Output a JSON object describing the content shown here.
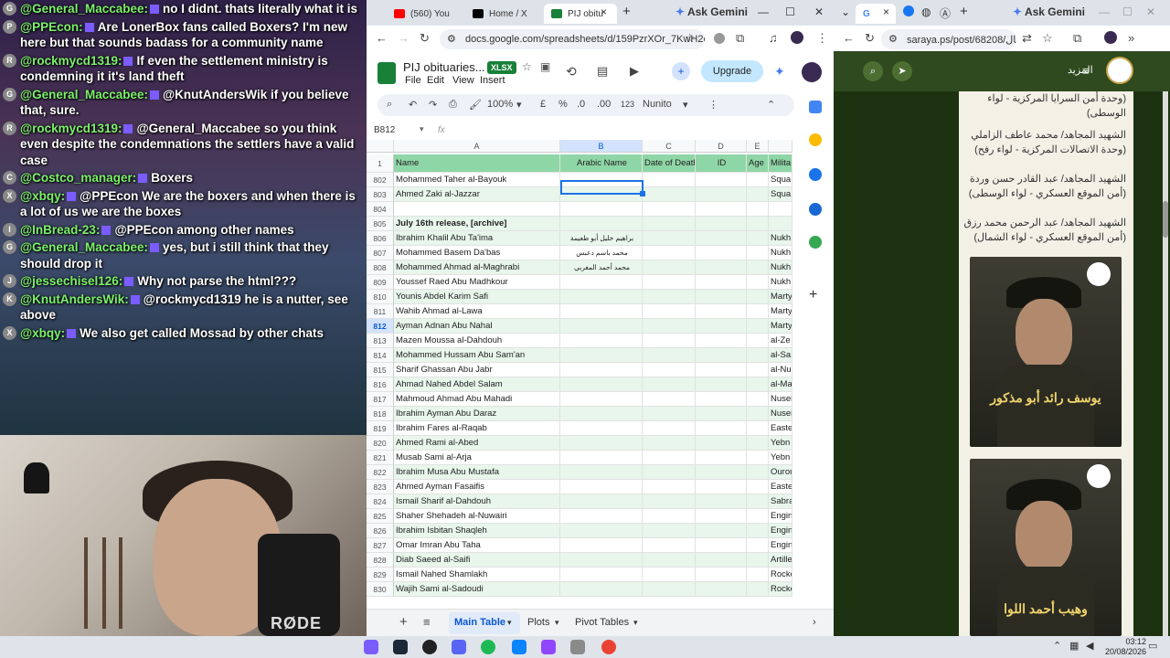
{
  "chat": [
    {
      "user": "@General_Maccabee:",
      "text": "no I didnt. thats literally what it is",
      "avatar": "G"
    },
    {
      "user": "@PPEcon:",
      "text": "Are LonerBox fans called Boxers? I'm new here but that sounds badass for a community name",
      "avatar": "P"
    },
    {
      "user": "@rockmycd1319:",
      "text": "If even the settlement ministry is condemning it it's land theft",
      "avatar": "R"
    },
    {
      "user": "@General_Maccabee:",
      "text": "@KnutAndersWik if you believe that, sure.",
      "avatar": "G"
    },
    {
      "user": "@rockmycd1319:",
      "text": "@General_Maccabee so you think even despite the condemnations the settlers have a valid case",
      "avatar": "R"
    },
    {
      "user": "@Costco_manager:",
      "text": "Boxers",
      "avatar": "C"
    },
    {
      "user": "@xbqy:",
      "text": "@PPEcon We are the boxers and when there is a lot of us we are the boxes",
      "avatar": "X"
    },
    {
      "user": "@InBread-23:",
      "text": "@PPEcon among other names",
      "avatar": "I"
    },
    {
      "user": "@General_Maccabee:",
      "text": "yes, but i still think that they should drop it",
      "avatar": "G"
    },
    {
      "user": "@jessechisel126:",
      "text": "Why not parse the html???",
      "avatar": "J"
    },
    {
      "user": "@KnutAndersWik:",
      "text": "@rockmycd1319 he is a nutter, see above",
      "avatar": "K"
    },
    {
      "user": "@xbqy:",
      "text": "We also get called Mossad by other chats",
      "avatar": "X"
    }
  ],
  "webcam": {
    "mic_brand": "RØDE"
  },
  "browserA": {
    "tabs": [
      {
        "label": "(560) You",
        "color": "#ff0000"
      },
      {
        "label": "Home / X",
        "color": "#000000"
      },
      {
        "label": "PIJ obitu",
        "color": "#188038"
      }
    ],
    "ask_gemini": "Ask Gemini",
    "url": "docs.google.com/spreadsheets/d/159PzrXOr_7KwH2ok...",
    "doc_title": "PIJ obituaries...",
    "badge": "XLSX",
    "menus": [
      "File",
      "Edit",
      "View",
      "Insert"
    ],
    "upgrade": "Upgrade",
    "toolbar": {
      "zoom": "100%",
      "currency": "£",
      "percent": "%",
      "dec_minus": ".0",
      "dec_plus": ".00",
      "number_format": "123",
      "font": "Nunito"
    },
    "namebox": "B812",
    "fx": "fx",
    "columns": [
      "A",
      "B",
      "C",
      "D",
      "E"
    ],
    "header_row": {
      "num": "1",
      "cells": [
        "Name",
        "Arabic Name",
        "Date of Death",
        "ID",
        "Age",
        "Milita"
      ]
    },
    "rows": [
      {
        "num": "802",
        "name": "Mohammed Taher al-Bayouk",
        "arabic": "",
        "mil": "Squa"
      },
      {
        "num": "803",
        "name": "Ahmed Zaki al-Jazzar",
        "arabic": "",
        "mil": "Squa"
      },
      {
        "num": "804",
        "name": "",
        "arabic": "",
        "mil": ""
      },
      {
        "num": "805",
        "name": "July 16th release, [archive]",
        "arabic": "",
        "mil": ""
      },
      {
        "num": "806",
        "name": "Ibrahim Khalil Abu Ta'ima",
        "arabic": "براهيم خليل أبو طعيمة",
        "mil": "Nukh"
      },
      {
        "num": "807",
        "name": "Mohammed Basem Da'bas",
        "arabic": "محمد باسم دعبس",
        "mil": "Nukh"
      },
      {
        "num": "808",
        "name": "Mohammed Ahmad al-Maghrabi",
        "arabic": "محمد أحمد المغربي",
        "mil": "Nukh"
      },
      {
        "num": "809",
        "name": "Youssef Raed Abu Madhkour",
        "arabic": "",
        "mil": "Nukh"
      },
      {
        "num": "810",
        "name": "Younis Abdel Karim Safi",
        "arabic": "",
        "mil": "Marty"
      },
      {
        "num": "811",
        "name": "Wahib Ahmad al-Lawa",
        "arabic": "",
        "mil": "Marty"
      },
      {
        "num": "812",
        "name": "Ayman Adnan Abu Nahal",
        "arabic": "",
        "mil": "Marty"
      },
      {
        "num": "813",
        "name": "Mazen Moussa al-Dahdouh",
        "arabic": "",
        "mil": "al-Ze"
      },
      {
        "num": "814",
        "name": "Mohammed Hussam Abu Sam'an",
        "arabic": "",
        "mil": "al-Sa"
      },
      {
        "num": "815",
        "name": "Sharif Ghassan Abu Jabr",
        "arabic": "",
        "mil": "al-Nu"
      },
      {
        "num": "816",
        "name": "Ahmad Nahed Abdel Salam",
        "arabic": "",
        "mil": "al-Ma"
      },
      {
        "num": "817",
        "name": "Mahmoud Ahmad Abu Mahadi",
        "arabic": "",
        "mil": "Nusei"
      },
      {
        "num": "818",
        "name": "Ibrahim Ayman Abu Daraz",
        "arabic": "",
        "mil": "Nusei"
      },
      {
        "num": "819",
        "name": "Ibrahim Fares al-Raqab",
        "arabic": "",
        "mil": "Easte"
      },
      {
        "num": "820",
        "name": "Ahmed Rami al-Abed",
        "arabic": "",
        "mil": "Yebn"
      },
      {
        "num": "821",
        "name": "Musab Sami al-Arja",
        "arabic": "",
        "mil": "Yebn"
      },
      {
        "num": "822",
        "name": "Ibrahim Musa Abu Mustafa",
        "arabic": "",
        "mil": "Ourou"
      },
      {
        "num": "823",
        "name": "Ahmed Ayman Fasaifis",
        "arabic": "",
        "mil": "Easte"
      },
      {
        "num": "824",
        "name": "Ismail Sharif al-Dahdouh",
        "arabic": "",
        "mil": "Sabra"
      },
      {
        "num": "825",
        "name": "Shaher Shehadeh al-Nuwairi",
        "arabic": "",
        "mil": "Engin"
      },
      {
        "num": "826",
        "name": "Ibrahim Isbitan Shaqleh",
        "arabic": "",
        "mil": "Engin"
      },
      {
        "num": "827",
        "name": "Omar Imran Abu Taha",
        "arabic": "",
        "mil": "Engin"
      },
      {
        "num": "828",
        "name": "Diab Saeed al-Saifi",
        "arabic": "",
        "mil": "Artille"
      },
      {
        "num": "829",
        "name": "Ismail Nahed Shamlakh",
        "arabic": "",
        "mil": "Rocke"
      },
      {
        "num": "830",
        "name": "Wajih Sami al-Sadoudi",
        "arabic": "",
        "mil": "Rocke"
      }
    ],
    "sheet_tabs": [
      "Main Table",
      "Plots",
      "Pivot Tables"
    ]
  },
  "browserB": {
    "ask_gemini": "Ask Gemini",
    "url": "saraya.ps/post/68208/بال...",
    "more": "المزيد",
    "texts": [
      "(وحدة أمن السرايا المركزية - لواء الوسطى)",
      "الشهيد المجاهد/ محمد عاطف الزاملي (وحدة الاتصالات المركزية - لواء رفح)",
      "الشهيد المجاهد/ عبد القادر حسن وردة (أمن الموقع العسكري - لواء الوسطى)",
      "الشهيد المجاهد/ عبد الرحمن محمد رزق (أمن الموقع العسكري - لواء الشمال)"
    ],
    "photo_captions": [
      "يوسف رائد أبو مذكور",
      "وهيب أحمد اللوا"
    ]
  },
  "taskbar": {
    "time": "03:12",
    "date": "20/08/2026"
  },
  "colors": {
    "sheets_green": "#188038",
    "header_green": "#8fd6a6",
    "alt_row": "#e8f6ec",
    "site_green": "#2e4a1e"
  }
}
